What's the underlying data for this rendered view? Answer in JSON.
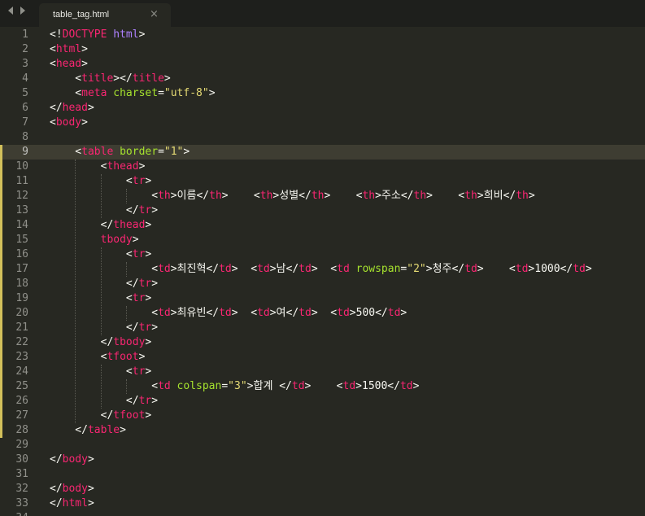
{
  "tab": {
    "title": "table_tag.html",
    "close_glyph": "×"
  },
  "icons": {
    "nav_back": "triangle-left-icon",
    "nav_forward": "triangle-right-icon",
    "close": "close-icon"
  },
  "theme": {
    "background": "#272822",
    "tabbar": "#1e1f1c",
    "line_highlight": "#3e3d32",
    "gutter_text": "#90908a",
    "modified_marker": "#d2c05b",
    "tag": "#f92672",
    "attribute": "#a6e22e",
    "string": "#e6db74",
    "doctype_keyword": "#ae81ff",
    "text": "#f8f8f2"
  },
  "editor": {
    "active_line": 9,
    "modified_lines": [
      9,
      10,
      11,
      12,
      13,
      14,
      15,
      16,
      17,
      18,
      19,
      20,
      21,
      22,
      23,
      24,
      25,
      26,
      27,
      28
    ],
    "lines": [
      {
        "n": "1",
        "tokens": [
          [
            "p",
            "<!"
          ],
          [
            "t",
            "DOCTYPE"
          ],
          [
            "p",
            " "
          ],
          [
            "k",
            "html"
          ],
          [
            "p",
            ">"
          ]
        ]
      },
      {
        "n": "2",
        "tokens": [
          [
            "p",
            "<"
          ],
          [
            "t",
            "html"
          ],
          [
            "p",
            ">"
          ]
        ]
      },
      {
        "n": "3",
        "tokens": [
          [
            "p",
            "<"
          ],
          [
            "t",
            "head"
          ],
          [
            "p",
            ">"
          ]
        ]
      },
      {
        "n": "4",
        "tokens": [
          [
            "p",
            "    <"
          ],
          [
            "t",
            "title"
          ],
          [
            "p",
            "></"
          ],
          [
            "t",
            "title"
          ],
          [
            "p",
            ">"
          ]
        ]
      },
      {
        "n": "5",
        "tokens": [
          [
            "p",
            "    <"
          ],
          [
            "t",
            "meta"
          ],
          [
            "p",
            " "
          ],
          [
            "a",
            "charset"
          ],
          [
            "p",
            "="
          ],
          [
            "s",
            "\"utf-8\""
          ],
          [
            "p",
            ">"
          ]
        ]
      },
      {
        "n": "6",
        "tokens": [
          [
            "p",
            "</"
          ],
          [
            "t",
            "head"
          ],
          [
            "p",
            ">"
          ]
        ]
      },
      {
        "n": "7",
        "tokens": [
          [
            "p",
            "<"
          ],
          [
            "t",
            "body"
          ],
          [
            "p",
            ">"
          ]
        ]
      },
      {
        "n": "8",
        "tokens": []
      },
      {
        "n": "9",
        "tokens": [
          [
            "p",
            "    <"
          ],
          [
            "t",
            "table"
          ],
          [
            "p",
            " "
          ],
          [
            "a",
            "border"
          ],
          [
            "p",
            "="
          ],
          [
            "s",
            "\"1\""
          ],
          [
            "p",
            ">"
          ]
        ]
      },
      {
        "n": "10",
        "tokens": [
          [
            "p",
            "        <"
          ],
          [
            "t",
            "thead"
          ],
          [
            "p",
            ">"
          ]
        ]
      },
      {
        "n": "11",
        "tokens": [
          [
            "p",
            "            <"
          ],
          [
            "t",
            "tr"
          ],
          [
            "p",
            ">"
          ]
        ]
      },
      {
        "n": "12",
        "tokens": [
          [
            "p",
            "                <"
          ],
          [
            "t",
            "th"
          ],
          [
            "p",
            ">이름</"
          ],
          [
            "t",
            "th"
          ],
          [
            "p",
            ">    <"
          ],
          [
            "t",
            "th"
          ],
          [
            "p",
            ">성별</"
          ],
          [
            "t",
            "th"
          ],
          [
            "p",
            ">    <"
          ],
          [
            "t",
            "th"
          ],
          [
            "p",
            ">주소</"
          ],
          [
            "t",
            "th"
          ],
          [
            "p",
            ">    <"
          ],
          [
            "t",
            "th"
          ],
          [
            "p",
            ">희비</"
          ],
          [
            "t",
            "th"
          ],
          [
            "p",
            ">"
          ]
        ]
      },
      {
        "n": "13",
        "tokens": [
          [
            "p",
            "            </"
          ],
          [
            "t",
            "tr"
          ],
          [
            "p",
            ">"
          ]
        ]
      },
      {
        "n": "14",
        "tokens": [
          [
            "p",
            "        </"
          ],
          [
            "t",
            "thead"
          ],
          [
            "p",
            ">"
          ]
        ]
      },
      {
        "n": "15",
        "tokens": [
          [
            "p",
            "        "
          ],
          [
            "t",
            "tbody"
          ],
          [
            "p",
            ">"
          ]
        ]
      },
      {
        "n": "16",
        "tokens": [
          [
            "p",
            "            <"
          ],
          [
            "t",
            "tr"
          ],
          [
            "p",
            ">"
          ]
        ]
      },
      {
        "n": "17",
        "tokens": [
          [
            "p",
            "                <"
          ],
          [
            "t",
            "td"
          ],
          [
            "p",
            ">최진혁</"
          ],
          [
            "t",
            "td"
          ],
          [
            "p",
            ">  <"
          ],
          [
            "t",
            "td"
          ],
          [
            "p",
            ">남</"
          ],
          [
            "t",
            "td"
          ],
          [
            "p",
            ">  <"
          ],
          [
            "t",
            "td"
          ],
          [
            "p",
            " "
          ],
          [
            "a",
            "rowspan"
          ],
          [
            "p",
            "="
          ],
          [
            "s",
            "\"2\""
          ],
          [
            "p",
            ">청주</"
          ],
          [
            "t",
            "td"
          ],
          [
            "p",
            ">    <"
          ],
          [
            "t",
            "td"
          ],
          [
            "p",
            ">1000</"
          ],
          [
            "t",
            "td"
          ],
          [
            "p",
            ">"
          ]
        ]
      },
      {
        "n": "18",
        "tokens": [
          [
            "p",
            "            </"
          ],
          [
            "t",
            "tr"
          ],
          [
            "p",
            ">"
          ]
        ]
      },
      {
        "n": "19",
        "tokens": [
          [
            "p",
            "            <"
          ],
          [
            "t",
            "tr"
          ],
          [
            "p",
            ">"
          ]
        ]
      },
      {
        "n": "20",
        "tokens": [
          [
            "p",
            "                <"
          ],
          [
            "t",
            "td"
          ],
          [
            "p",
            ">최유빈</"
          ],
          [
            "t",
            "td"
          ],
          [
            "p",
            ">  <"
          ],
          [
            "t",
            "td"
          ],
          [
            "p",
            ">여</"
          ],
          [
            "t",
            "td"
          ],
          [
            "p",
            ">  <"
          ],
          [
            "t",
            "td"
          ],
          [
            "p",
            ">500</"
          ],
          [
            "t",
            "td"
          ],
          [
            "p",
            ">"
          ]
        ]
      },
      {
        "n": "21",
        "tokens": [
          [
            "p",
            "            </"
          ],
          [
            "t",
            "tr"
          ],
          [
            "p",
            ">"
          ]
        ]
      },
      {
        "n": "22",
        "tokens": [
          [
            "p",
            "        </"
          ],
          [
            "t",
            "tbody"
          ],
          [
            "p",
            ">"
          ]
        ]
      },
      {
        "n": "23",
        "tokens": [
          [
            "p",
            "        <"
          ],
          [
            "t",
            "tfoot"
          ],
          [
            "p",
            ">"
          ]
        ]
      },
      {
        "n": "24",
        "tokens": [
          [
            "p",
            "            <"
          ],
          [
            "t",
            "tr"
          ],
          [
            "p",
            ">"
          ]
        ]
      },
      {
        "n": "25",
        "tokens": [
          [
            "p",
            "                <"
          ],
          [
            "t",
            "td"
          ],
          [
            "p",
            " "
          ],
          [
            "a",
            "colspan"
          ],
          [
            "p",
            "="
          ],
          [
            "s",
            "\"3\""
          ],
          [
            "p",
            ">합계 </"
          ],
          [
            "t",
            "td"
          ],
          [
            "p",
            ">    <"
          ],
          [
            "t",
            "td"
          ],
          [
            "p",
            ">1500</"
          ],
          [
            "t",
            "td"
          ],
          [
            "p",
            ">"
          ]
        ]
      },
      {
        "n": "26",
        "tokens": [
          [
            "p",
            "            </"
          ],
          [
            "t",
            "tr"
          ],
          [
            "p",
            ">"
          ]
        ]
      },
      {
        "n": "27",
        "tokens": [
          [
            "p",
            "        </"
          ],
          [
            "t",
            "tfoot"
          ],
          [
            "p",
            ">"
          ]
        ]
      },
      {
        "n": "28",
        "tokens": [
          [
            "p",
            "    </"
          ],
          [
            "t",
            "table"
          ],
          [
            "p",
            ">"
          ]
        ]
      },
      {
        "n": "29",
        "tokens": []
      },
      {
        "n": "30",
        "tokens": [
          [
            "p",
            "</"
          ],
          [
            "t",
            "body"
          ],
          [
            "p",
            ">"
          ]
        ]
      },
      {
        "n": "31",
        "tokens": []
      },
      {
        "n": "32",
        "tokens": [
          [
            "p",
            "</"
          ],
          [
            "t",
            "body"
          ],
          [
            "p",
            ">"
          ]
        ]
      },
      {
        "n": "33",
        "tokens": [
          [
            "p",
            "</"
          ],
          [
            "t",
            "html"
          ],
          [
            "p",
            ">"
          ]
        ]
      },
      {
        "n": "34",
        "tokens": []
      }
    ]
  }
}
